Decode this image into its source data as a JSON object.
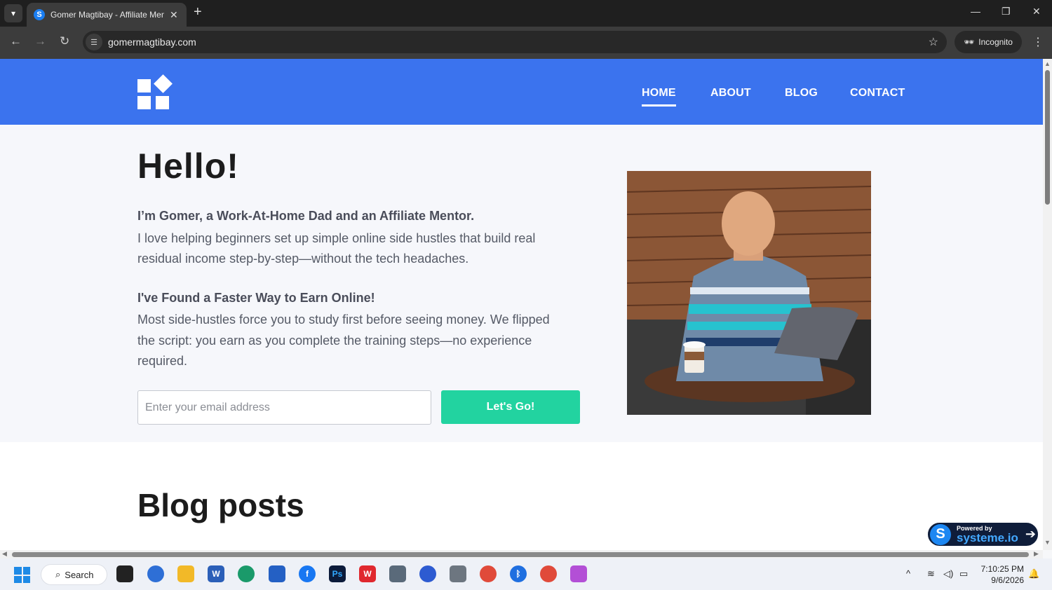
{
  "browser": {
    "tab_title": "Gomer Magtibay - Affiliate Mentor",
    "url": "gomermagtibay.com",
    "incognito_label": "Incognito"
  },
  "site": {
    "nav": [
      "HOME",
      "ABOUT",
      "BLOG",
      "CONTACT"
    ],
    "active_nav": "HOME",
    "hero": {
      "heading": "Hello!",
      "intro_bold": "I’m Gomer, a Work-At-Home Dad and an Affiliate Mentor.",
      "intro_text": "I love helping beginners set up simple online side hustles that build real residual income step-by-step—without the tech headaches.",
      "found_bold": "I've Found a Faster Way to Earn Online!",
      "found_text": "Most side-hustles force you to study first before seeing money. We flipped the script: you earn as you complete the training steps—no experience required.",
      "email_placeholder": "Enter your email address",
      "cta_label": "Let's Go!"
    },
    "blog_heading": "Blog posts",
    "powered_by": {
      "small": "Powered by",
      "brand": "systeme.io"
    }
  },
  "taskbar": {
    "search_label": "Search",
    "time": "7:10:25 PM",
    "date": "9/6/2026"
  },
  "colors": {
    "header_blue": "#3b73ee",
    "cta_green": "#22d3a0",
    "chrome_dark": "#1f1f1f"
  }
}
